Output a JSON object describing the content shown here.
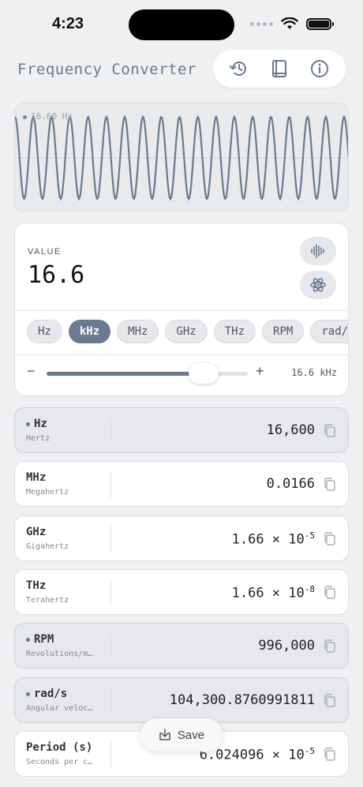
{
  "status": {
    "time": "4:23"
  },
  "header": {
    "title": "Frequency Converter",
    "icons": [
      "history-icon",
      "book-icon",
      "info-icon"
    ]
  },
  "wave": {
    "label": "16.60 Hz",
    "color": "#6a7a8f"
  },
  "input": {
    "caption": "VALUE",
    "value": "16.6",
    "units": [
      "Hz",
      "kHz",
      "MHz",
      "GHz",
      "THz",
      "RPM",
      "rad/s"
    ],
    "selected_unit": "kHz",
    "slider_level": 0.78,
    "slider_readout": "16.6 kHz"
  },
  "results": [
    {
      "name": "Hz",
      "sub": "Hertz",
      "value": "16,600",
      "highlight": true
    },
    {
      "name": "MHz",
      "sub": "Megahertz",
      "value": "0.0166",
      "highlight": false
    },
    {
      "name": "GHz",
      "sub": "Gigahertz",
      "mantissa": "1.66 × 10",
      "exp": "-5",
      "highlight": false
    },
    {
      "name": "THz",
      "sub": "Terahertz",
      "mantissa": "1.66 × 10",
      "exp": "-8",
      "highlight": false
    },
    {
      "name": "RPM",
      "sub": "Revolutions/m…",
      "value": "996,000",
      "highlight": true
    },
    {
      "name": "rad/s",
      "sub": "Angular veloc…",
      "value": "104,300.8760991811",
      "highlight": true
    },
    {
      "name": "Period (s)",
      "sub": "Seconds per c…",
      "mantissa": "6.024096 × 10",
      "exp": "-5",
      "highlight": false
    }
  ],
  "save": {
    "label": "Save"
  },
  "colors": {
    "accent": "#6a7a8f",
    "background": "#eef0f2",
    "card": "#ffffff"
  }
}
